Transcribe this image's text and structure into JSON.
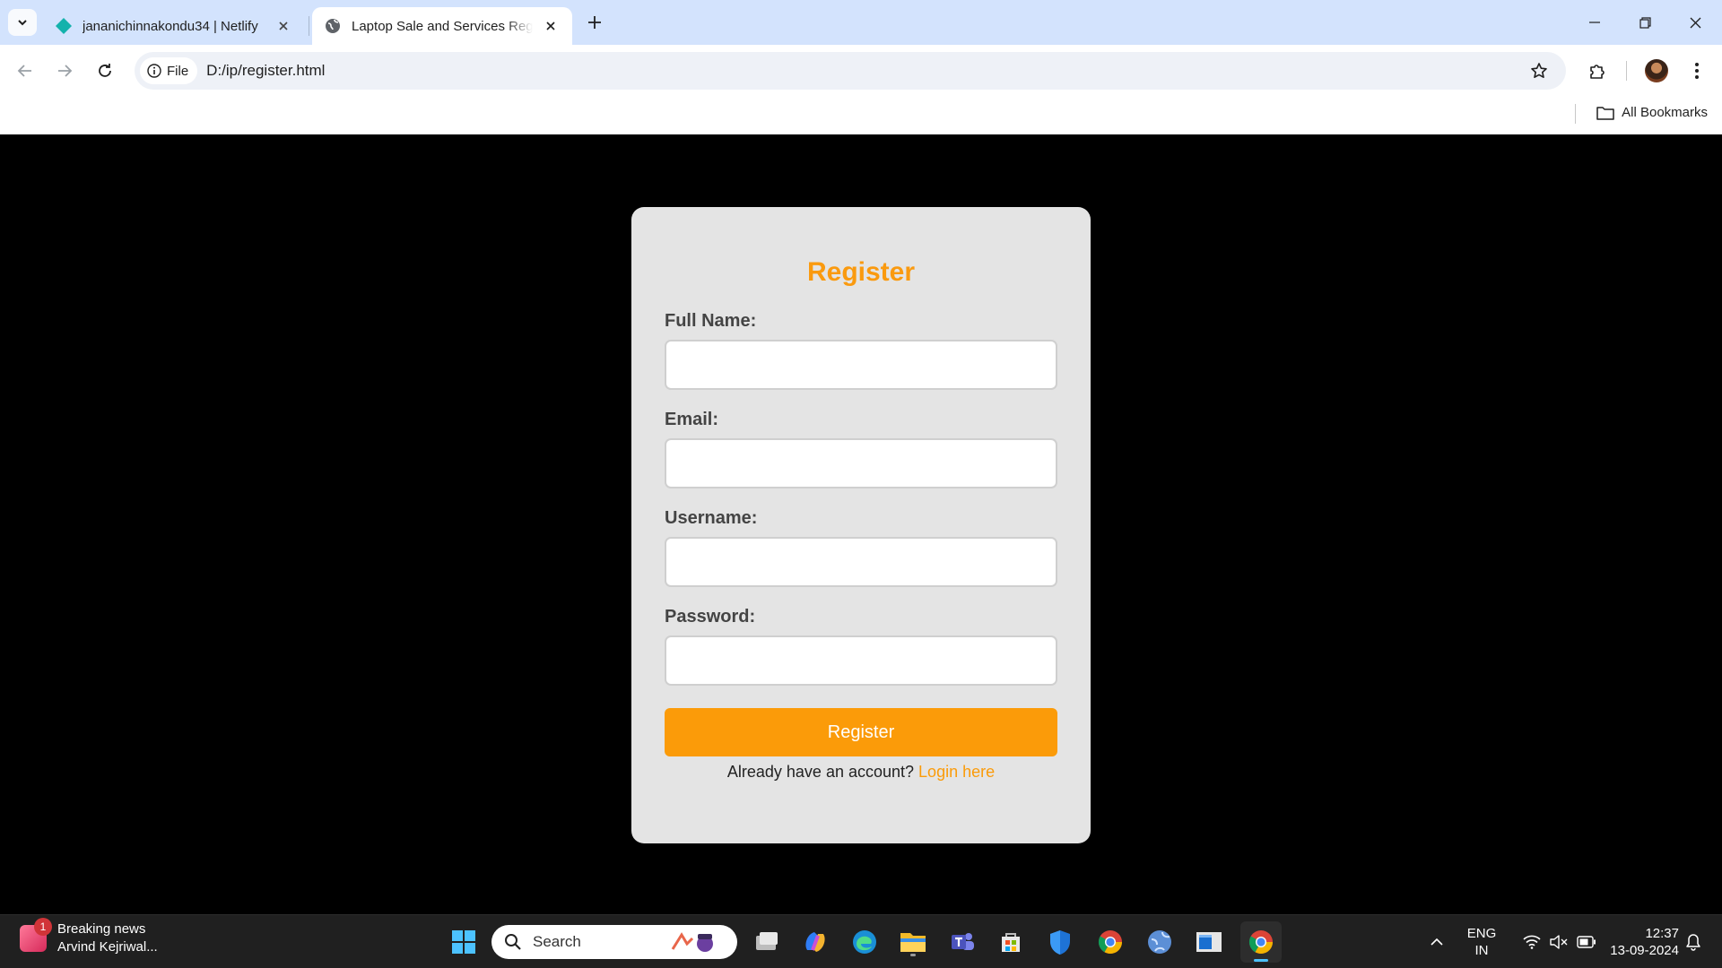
{
  "browser": {
    "tabs": [
      {
        "title": "jananichinnakondu34 | Netlify",
        "active": false
      },
      {
        "title": "Laptop Sale and Services Registration",
        "active": true
      }
    ],
    "address": {
      "chip_label": "File",
      "url": "D:/ip/register.html"
    },
    "bookmarks": {
      "all_label": "All Bookmarks"
    }
  },
  "page": {
    "heading": "Register",
    "fields": [
      {
        "label": "Full Name:",
        "value": "",
        "placeholder": ""
      },
      {
        "label": "Email:",
        "value": "",
        "placeholder": ""
      },
      {
        "label": "Username:",
        "value": "",
        "placeholder": ""
      },
      {
        "label": "Password:",
        "value": "",
        "placeholder": ""
      }
    ],
    "submit_label": "Register",
    "login_prompt": "Already have an account?",
    "login_link": "Login here",
    "colors": {
      "accent": "#fb9b09",
      "card": "#e4e4e4",
      "background": "#000000"
    }
  },
  "taskbar": {
    "news_badge": "1",
    "news_title": "Breaking news",
    "news_subtitle": "Arvind Kejriwal...",
    "search_placeholder": "Search",
    "lang_primary": "ENG",
    "lang_secondary": "IN",
    "time": "12:37",
    "date": "13-09-2024"
  }
}
